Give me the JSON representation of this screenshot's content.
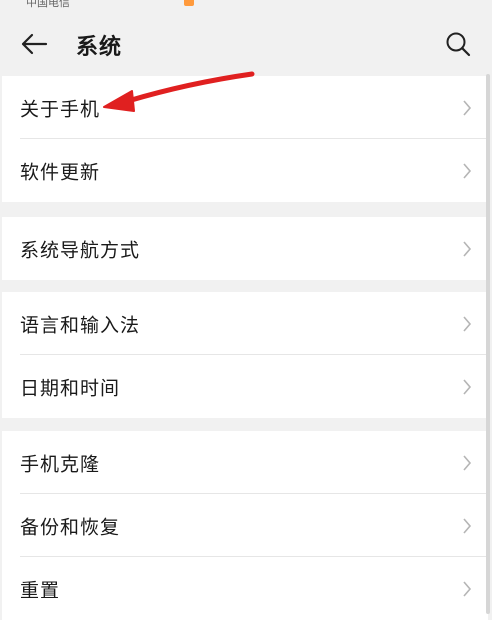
{
  "status_bar": {
    "carrier": "中国电信"
  },
  "header": {
    "title": "系统",
    "back_icon": "arrow-left-icon",
    "search_icon": "search-icon"
  },
  "groups": [
    {
      "items": [
        {
          "label": "关于手机"
        },
        {
          "label": "软件更新"
        }
      ]
    },
    {
      "items": [
        {
          "label": "系统导航方式"
        }
      ]
    },
    {
      "items": [
        {
          "label": "语言和输入法"
        },
        {
          "label": "日期和时间"
        }
      ]
    },
    {
      "items": [
        {
          "label": "手机克隆"
        },
        {
          "label": "备份和恢复"
        },
        {
          "label": "重置"
        }
      ]
    }
  ],
  "colors": {
    "background": "#f1f1f1",
    "card": "#ffffff",
    "annotation_arrow": "#e02020",
    "chevron": "#b5b5b5"
  }
}
